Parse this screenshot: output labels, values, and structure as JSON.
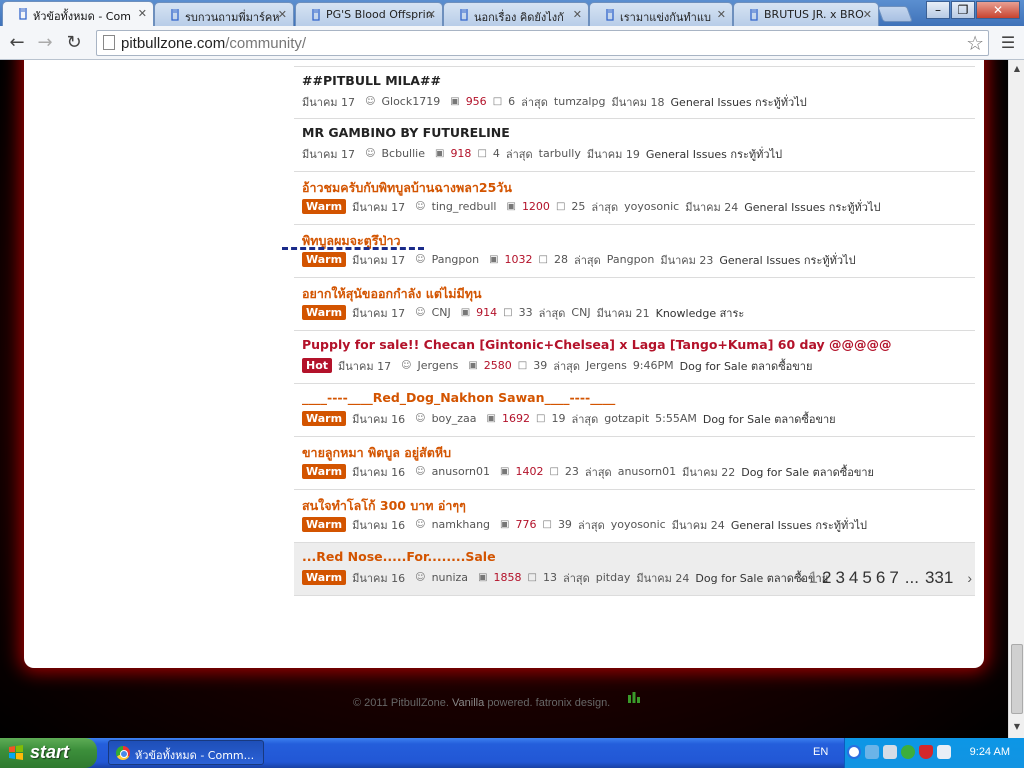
{
  "browser": {
    "tabs": [
      {
        "label": "หัวข้อทั้งหมด - Com",
        "active": true
      },
      {
        "label": "รบกวนถามพี่มาร์คห",
        "active": false
      },
      {
        "label": "PG'S Blood Offsprin",
        "active": false
      },
      {
        "label": "นอกเรื่อง คิดยังไงกั",
        "active": false
      },
      {
        "label": "เรามาแข่งกันทำแบ",
        "active": false
      },
      {
        "label": "BRUTUS JR. x BRO",
        "active": false
      }
    ],
    "url_host": "pitbullzone.com",
    "url_path": "/community/"
  },
  "labels": {
    "latest": "ล่าสุด",
    "warm": "Warm",
    "hot": "Hot"
  },
  "threads": [
    {
      "title": "##PITBULL MILA##",
      "badge": "",
      "date": "มีนาคม 17",
      "author": "Glock1719",
      "views": "956",
      "replies": "6",
      "last_user": "tumzalpg",
      "last_time": "มีนาคม 18",
      "category": "General Issues กระทู้ทั่วไป"
    },
    {
      "title": "MR GAMBINO BY FUTURELINE",
      "badge": "",
      "date": "มีนาคม 17",
      "author": "Bcbullie",
      "views": "918",
      "replies": "4",
      "last_user": "tarbully",
      "last_time": "มีนาคม 19",
      "category": "General Issues กระทู้ทั่วไป"
    },
    {
      "title": "อ้าวชมครับกับพิทบูลบ้านฉางพลา25วัน",
      "badge": "warm",
      "date": "มีนาคม 17",
      "author": "ting_redbull",
      "views": "1200",
      "replies": "25",
      "last_user": "yoyosonic",
      "last_time": "มีนาคม 24",
      "category": "General Issues กระทู้ทั่วไป"
    },
    {
      "title": "พิทบูลผมจะตูรึป่าว",
      "badge": "warm",
      "date": "มีนาคม 17",
      "author": "Pangpon",
      "views": "1032",
      "replies": "28",
      "last_user": "Pangpon",
      "last_time": "มีนาคม 23",
      "category": "General Issues กระทู้ทั่วไป"
    },
    {
      "title": "อยากให้สุนัขออกกำลัง แต่ไม่มีทุน",
      "badge": "warm",
      "date": "มีนาคม 17",
      "author": "CNJ",
      "views": "914",
      "replies": "33",
      "last_user": "CNJ",
      "last_time": "มีนาคม 21",
      "category": "Knowledge สาระ"
    },
    {
      "title": "Pupply for sale!! Checan [Gintonic+Chelsea] x Laga [Tango+Kuma] 60 day @@@@@",
      "badge": "hot",
      "date": "มีนาคม 17",
      "author": "Jergens",
      "views": "2580",
      "replies": "39",
      "last_user": "Jergens",
      "last_time": "9:46PM",
      "category": "Dog for Sale ตลาดซื้อขาย"
    },
    {
      "title": "____----____Red_Dog_Nakhon Sawan____----____",
      "badge": "warm",
      "date": "มีนาคม 16",
      "author": "boy_zaa",
      "views": "1692",
      "replies": "19",
      "last_user": "gotzapit",
      "last_time": "5:55AM",
      "category": "Dog for Sale ตลาดซื้อขาย"
    },
    {
      "title": "ขายลูกหมา พิตบูล อยู่สัตหีบ",
      "badge": "warm",
      "date": "มีนาคม 16",
      "author": "anusorn01",
      "views": "1402",
      "replies": "23",
      "last_user": "anusorn01",
      "last_time": "มีนาคม 22",
      "category": "Dog for Sale ตลาดซื้อขาย"
    },
    {
      "title": "สนใจทำโลโก้ 300 บาท อ่าๆๆ",
      "badge": "warm",
      "date": "มีนาคม 16",
      "author": "namkhang",
      "views": "776",
      "replies": "39",
      "last_user": "yoyosonic",
      "last_time": "มีนาคม 24",
      "category": "General Issues กระทู้ทั่วไป"
    },
    {
      "title": "...Red Nose.....For........Sale",
      "badge": "warm",
      "date": "มีนาคม 16",
      "author": "nuniza",
      "views": "1858",
      "replies": "13",
      "last_user": "pitday",
      "last_time": "มีนาคม 24",
      "category": "Dog for Sale ตลาดซื้อขาย"
    }
  ],
  "pagination": {
    "prev": "‹",
    "pages": [
      "1",
      "2",
      "3",
      "4",
      "5",
      "6",
      "7"
    ],
    "current": "1",
    "ellipsis": "...",
    "last": "331",
    "next": "›"
  },
  "footer": {
    "copyright": "© 2011 PitbullZone.",
    "vanilla": "Vanilla",
    "powered": "powered.",
    "design": "fatronix design."
  },
  "taskbar": {
    "start_label": "start",
    "window_item": "หัวข้อทั้งหมด - Comm...",
    "language": "EN",
    "clock": "9:24 AM"
  },
  "colors": {
    "warm": "#d35400",
    "hot": "#b3122a",
    "glow": "#a00000",
    "taskbar": "#245edb",
    "start": "#3c8f3b"
  }
}
